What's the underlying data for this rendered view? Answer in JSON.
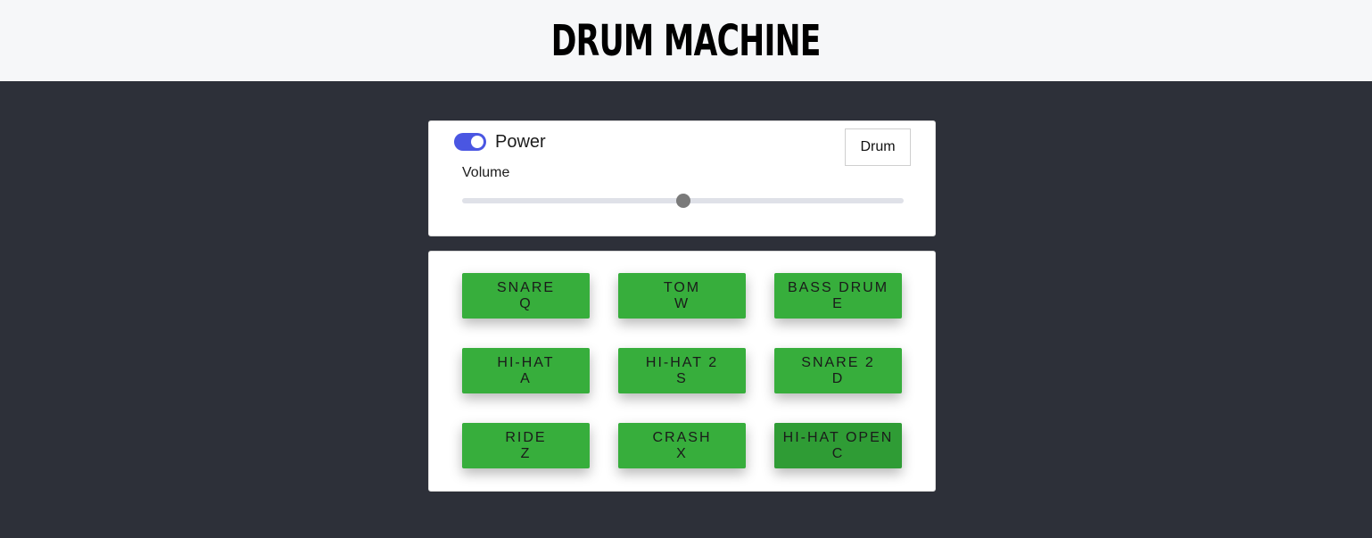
{
  "header": {
    "title": "DRUM MACHINE"
  },
  "controls": {
    "power_label": "Power",
    "power_on": true,
    "volume_label": "Volume",
    "volume_fraction": 0.5,
    "display_text": "Drum"
  },
  "colors": {
    "pad": "#37ae3c",
    "pad_active": "#2f9c35",
    "toggle": "#4a56e2",
    "background": "#2d3039"
  },
  "pads": [
    {
      "name": "SNARE",
      "key": "Q"
    },
    {
      "name": "TOM",
      "key": "W"
    },
    {
      "name": "BASS DRUM",
      "key": "E"
    },
    {
      "name": "HI-HAT",
      "key": "A"
    },
    {
      "name": "HI-HAT 2",
      "key": "S"
    },
    {
      "name": "SNARE 2",
      "key": "D"
    },
    {
      "name": "RIDE",
      "key": "Z"
    },
    {
      "name": "CRASH",
      "key": "X"
    },
    {
      "name": "HI-HAT OPEN",
      "key": "C",
      "active": true
    }
  ]
}
